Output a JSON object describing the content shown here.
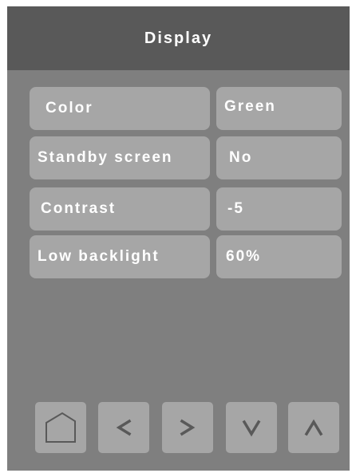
{
  "header": {
    "title": "Display"
  },
  "settings": [
    {
      "label": "Color",
      "value": "Green"
    },
    {
      "label": "Standby screen",
      "value": "No"
    },
    {
      "label": "Contrast",
      "value": "-5"
    },
    {
      "label": "Low backlight",
      "value": "60%"
    }
  ],
  "nav": [
    {
      "icon": "home-icon"
    },
    {
      "icon": "chevron-left-icon"
    },
    {
      "icon": "chevron-right-icon"
    },
    {
      "icon": "chevron-down-icon"
    },
    {
      "icon": "chevron-up-icon"
    }
  ],
  "colors": {
    "outer": "#ffffff",
    "screen": "#7f7f7f",
    "header": "#595959",
    "cell": "#a6a6a6",
    "text": "#ffffff",
    "icon": "#595959"
  }
}
